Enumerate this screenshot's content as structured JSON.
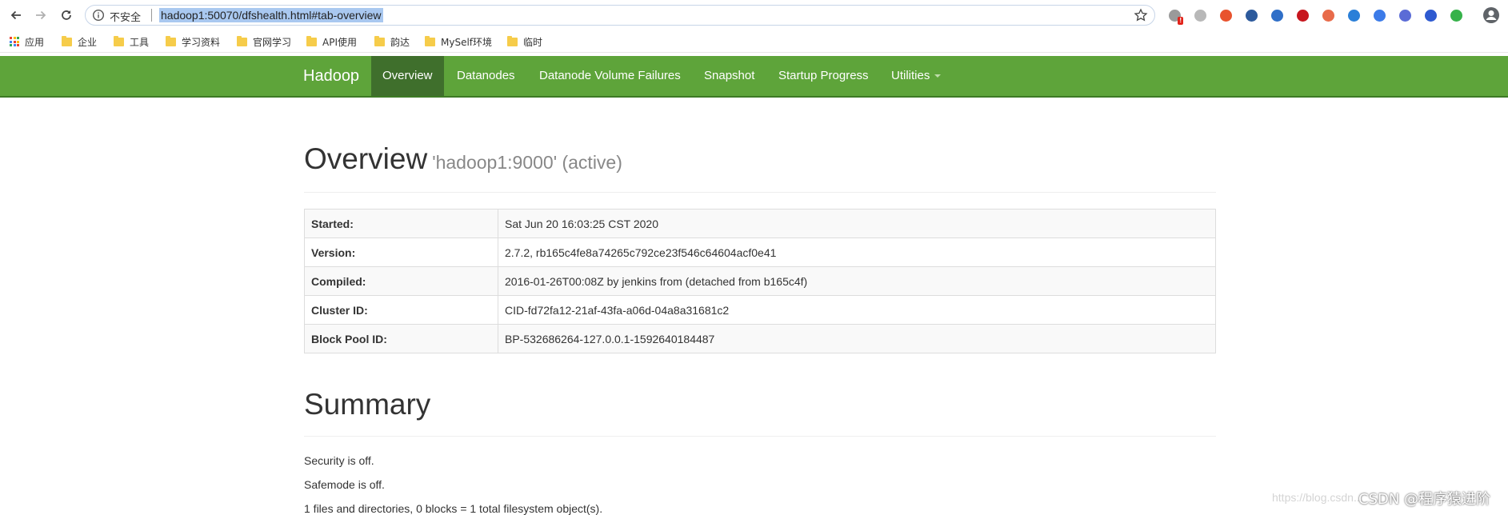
{
  "browser": {
    "security_label": "不安全",
    "url": "hadoop1:50070/dfshealth.html#tab-overview",
    "bookmarks": [
      "应用",
      "企业",
      "工具",
      "学习资料",
      "官网学习",
      "API使用",
      "韵达",
      "MySelf环境",
      "临时"
    ],
    "extensions": [
      {
        "name": "ext-1-icon",
        "color": "#9a9a9a",
        "badge": "!"
      },
      {
        "name": "ext-2-icon",
        "color": "#b8b8b8"
      },
      {
        "name": "ext-3-icon",
        "color": "#e8532e"
      },
      {
        "name": "ext-4-icon",
        "color": "#2d5a9c"
      },
      {
        "name": "ext-5-icon",
        "color": "#2f6fc8"
      },
      {
        "name": "ext-abp-icon",
        "color": "#c7161e"
      },
      {
        "name": "ext-7-icon",
        "color": "#e86b4a"
      },
      {
        "name": "ext-8-icon",
        "color": "#2a7fd8"
      },
      {
        "name": "ext-translate-icon",
        "color": "#3c7be8"
      },
      {
        "name": "ext-10-icon",
        "color": "#5b6cd6"
      },
      {
        "name": "ext-11-icon",
        "color": "#2e5ad0"
      },
      {
        "name": "ext-12-icon",
        "color": "#36b24a"
      }
    ]
  },
  "navbar": {
    "brand": "Hadoop",
    "items": [
      "Overview",
      "Datanodes",
      "Datanode Volume Failures",
      "Snapshot",
      "Startup Progress",
      "Utilities"
    ],
    "active": "Overview",
    "bg_color": "#5ea43a",
    "active_color": "#3f6f2c"
  },
  "overview": {
    "title": "Overview",
    "subtitle": "'hadoop1:9000' (active)",
    "rows": [
      {
        "key": "Started:",
        "value": "Sat Jun 20 16:03:25 CST 2020"
      },
      {
        "key": "Version:",
        "value": "2.7.2, rb165c4fe8a74265c792ce23f546c64604acf0e41"
      },
      {
        "key": "Compiled:",
        "value": "2016-01-26T00:08Z by jenkins from (detached from b165c4f)"
      },
      {
        "key": "Cluster ID:",
        "value": "CID-fd72fa12-21af-43fa-a06d-04a8a31681c2"
      },
      {
        "key": "Block Pool ID:",
        "value": "BP-532686264-127.0.0.1-1592640184487"
      }
    ]
  },
  "summary": {
    "title": "Summary",
    "lines": [
      "Security is off.",
      "Safemode is off.",
      "1 files and directories, 0 blocks = 1 total filesystem object(s)."
    ]
  },
  "watermark": {
    "faint": "https://blog.csdn...",
    "text": "CSDN @程序猿进阶"
  }
}
